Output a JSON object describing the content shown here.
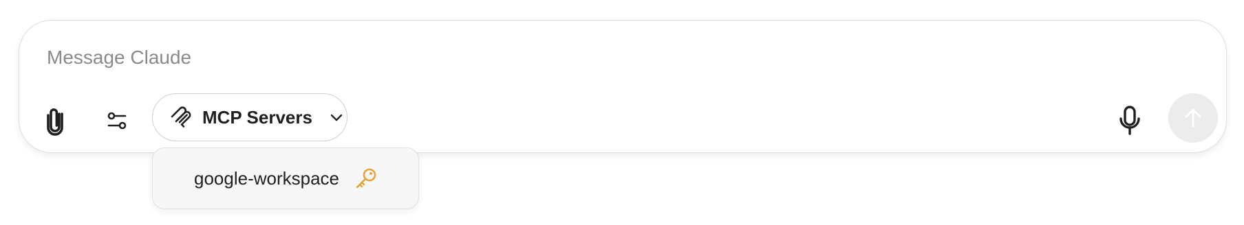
{
  "composer": {
    "placeholder": "Message Claude",
    "value": ""
  },
  "toolbar": {
    "attach_icon": "paperclip-icon",
    "tools_icon": "sliders-icon",
    "mcp_button": {
      "label": "MCP Servers",
      "icon": "mcp-icon",
      "chevron": "chevron-down-icon"
    },
    "mic_icon": "microphone-icon",
    "send_icon": "arrow-up-icon"
  },
  "mcp_dropdown": {
    "items": [
      {
        "label": "google-workspace",
        "icon": "key-icon",
        "icon_color": "#e8a33a"
      }
    ]
  },
  "colors": {
    "border": "#dedede",
    "send_button_bg": "#ececec",
    "dropdown_bg": "#f7f7f7",
    "key_accent": "#e8a33a",
    "text": "#1f1f1f",
    "placeholder": "#8a8a8a"
  }
}
